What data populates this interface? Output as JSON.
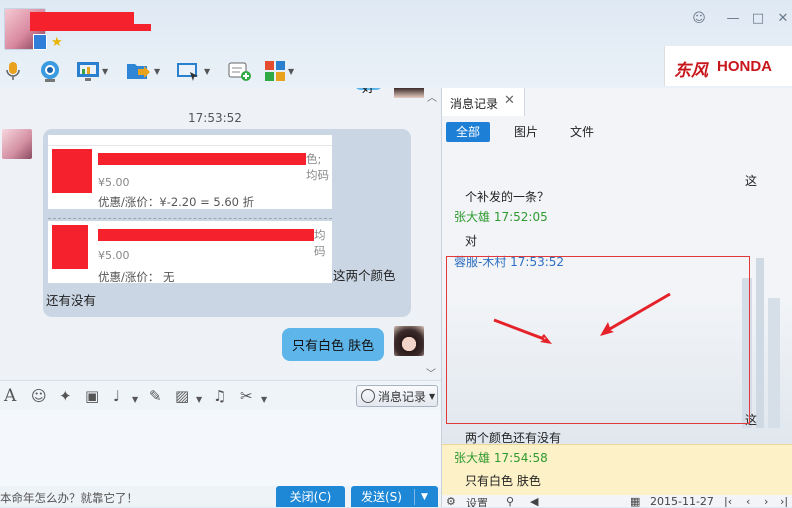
{
  "header": {
    "star": "★",
    "window_buttons": [
      "☺",
      "—",
      "□",
      "✕"
    ],
    "tools": [
      "microphone-icon",
      "camera-icon",
      "screen-share-icon",
      "file-transfer-icon",
      "remote-desktop-icon",
      "add-app-icon",
      "apps-grid-icon"
    ],
    "brand_cn": "东风",
    "brand_en": "HONDA"
  },
  "chat": {
    "top_partial_bubble": "好",
    "timestamp": "17:53:52",
    "card1": {
      "title_tail": "色;均码",
      "price": "¥5.00",
      "discount": "优惠/涨价：¥-2.20 = 5.60 折"
    },
    "card2": {
      "title_tail": "均码",
      "price": "¥5.00",
      "discount": "优惠/涨价： 无"
    },
    "question_line1": "这两个颜色",
    "question_line2": "还有没有",
    "reply": "只有白色  肤色"
  },
  "input_toolbar": {
    "font_label": "A",
    "history_label": "消息记录"
  },
  "footer": {
    "tip": "本命年怎么办？就靠它了！",
    "close_label": "关闭(C)",
    "send_label": "发送(S)"
  },
  "panel": {
    "tab_title": "消息记录",
    "tab_close": "✕",
    "filters": [
      "全部",
      "图片",
      "文件"
    ],
    "messages": [
      {
        "kind": "text",
        "text": "这"
      },
      {
        "kind": "text",
        "text": "个补发的一条？"
      },
      {
        "kind": "name",
        "text": "张大雄 17:52:05"
      },
      {
        "kind": "text",
        "text": "对"
      },
      {
        "kind": "name_blue",
        "text": "蓉服-木村 17:53:52"
      },
      {
        "kind": "text",
        "text": "这"
      },
      {
        "kind": "text",
        "text": "两个颜色还有没有"
      },
      {
        "kind": "name",
        "text": "张大雄 17:54:58"
      },
      {
        "kind": "text",
        "text": "只有白色  肤色"
      }
    ],
    "bottom": {
      "settings": "设置",
      "date": "2015-11-27"
    }
  },
  "colors": {
    "accent": "#1f88d6",
    "bubble_blue": "#5eb5ea",
    "annotation_red": "#e03a3a",
    "highlight": "#fdf1c8"
  }
}
